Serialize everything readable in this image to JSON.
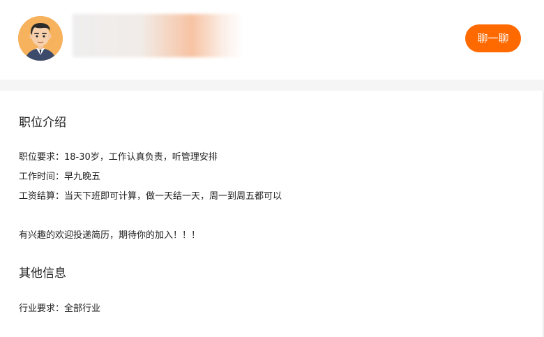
{
  "header": {
    "chat_button_label": "聊一聊"
  },
  "sections": {
    "intro": {
      "title": "职位介绍",
      "requirement": "职位要求：18-30岁，工作认真负责，听管理安排",
      "hours": "工作时间：早九晚五",
      "pay": "工资结算：当天下班即可计算，做一天结一天，周一到周五都可以",
      "closing": "有兴趣的欢迎投递简历，期待你的加入！！！"
    },
    "other": {
      "title": "其他信息",
      "industry": "行业要求：全部行业"
    }
  },
  "colors": {
    "accent": "#ff6a00",
    "avatar_bg": "#f6b25c",
    "divider": "#f5f5f6"
  }
}
